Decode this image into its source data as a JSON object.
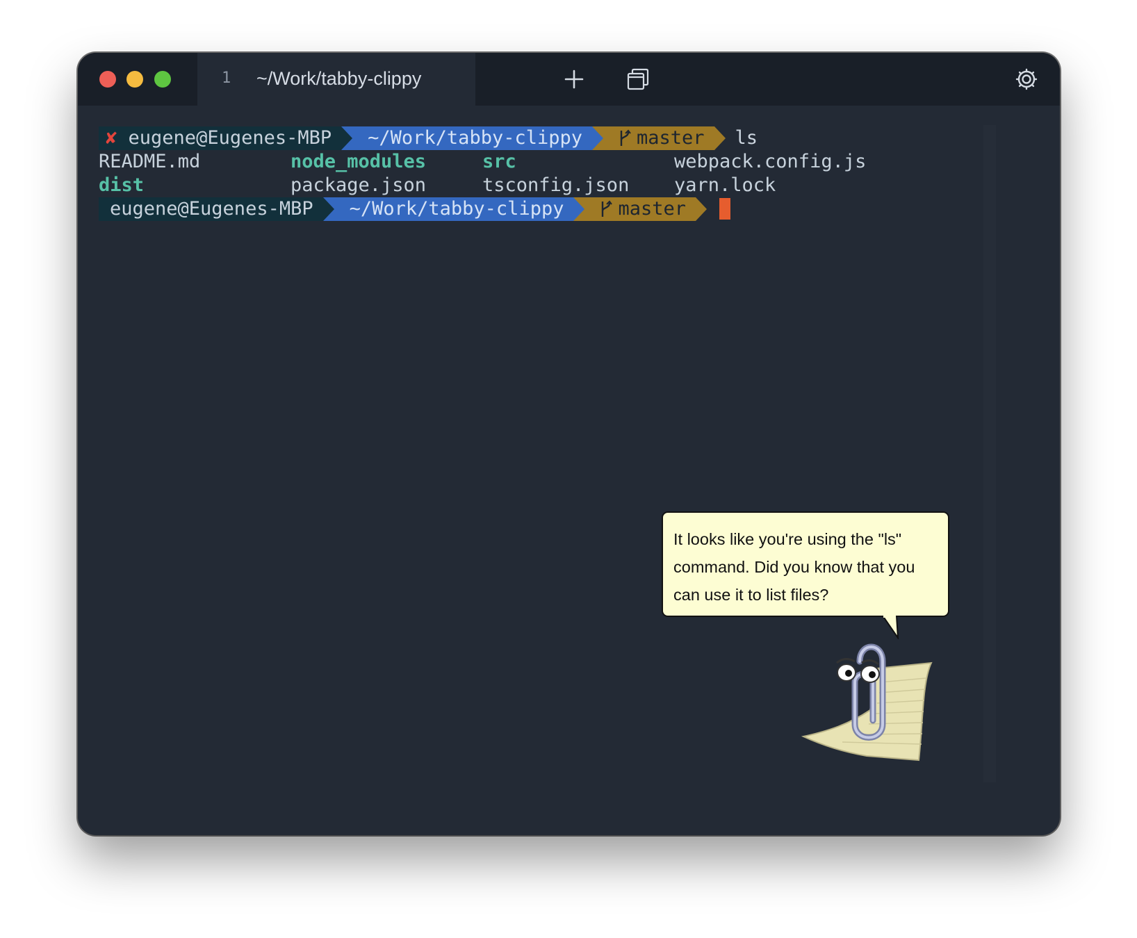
{
  "window": {
    "tab": {
      "number": "1",
      "title": "~/Work/tabby-clippy"
    },
    "icons": [
      "plus-icon",
      "windows-icon",
      "gear-icon"
    ]
  },
  "prompt1": {
    "status": "✘",
    "context": "eugene@Eugenes-MBP",
    "directory": "~/Work/tabby-clippy",
    "branch_icon": "git-branch-icon",
    "branch": "master",
    "command": "ls"
  },
  "files": [
    {
      "name": "README.md",
      "type": "file"
    },
    {
      "name": "node_modules",
      "type": "dir"
    },
    {
      "name": "src",
      "type": "dir"
    },
    {
      "name": "webpack.config.js",
      "type": "file"
    },
    {
      "name": "dist",
      "type": "dir"
    },
    {
      "name": "package.json",
      "type": "file"
    },
    {
      "name": "tsconfig.json",
      "type": "file"
    },
    {
      "name": "yarn.lock",
      "type": "file"
    }
  ],
  "prompt2": {
    "context": "eugene@Eugenes-MBP",
    "directory": "~/Work/tabby-clippy",
    "branch": "master"
  },
  "clippy": {
    "line1": "It looks like you're using the \"ls\"",
    "line2": "command. Did you know that you",
    "line3": "can use it to list files?"
  },
  "colors": {
    "terminal_bg": "#232a35",
    "titlebar_bg": "#191f28",
    "segment_context": "#12303b",
    "segment_directory": "#3468c0",
    "segment_git": "#9f7a25",
    "directory_listing": "#57c1a7",
    "cursor": "#e65d2e",
    "bubble_bg": "#fdfdd3"
  }
}
